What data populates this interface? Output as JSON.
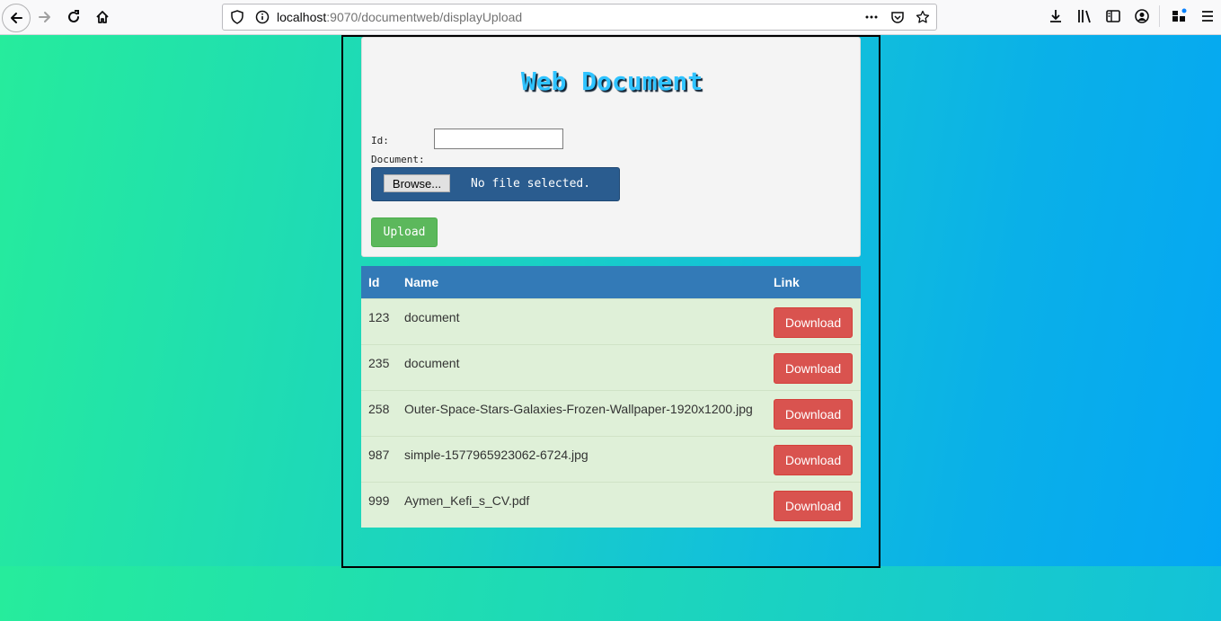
{
  "browser": {
    "url_host": "localhost",
    "url_port_path": ":9070/documentweb/displayUpload"
  },
  "form": {
    "title": "Web Document",
    "id_label": "Id:",
    "id_value": "",
    "document_label": "Document:",
    "browse_label": "Browse...",
    "file_status": "No file selected.",
    "upload_label": "Upload"
  },
  "table": {
    "headers": {
      "id": "Id",
      "name": "Name",
      "link": "Link"
    },
    "rows": [
      {
        "id": "123",
        "name": "document",
        "link": "Download"
      },
      {
        "id": "235",
        "name": "document",
        "link": "Download"
      },
      {
        "id": "258",
        "name": "Outer-Space-Stars-Galaxies-Frozen-Wallpaper-1920x1200.jpg",
        "link": "Download"
      },
      {
        "id": "987",
        "name": "simple-1577965923062-6724.jpg",
        "link": "Download"
      },
      {
        "id": "999",
        "name": "Aymen_Kefi_s_CV.pdf",
        "link": "Download"
      }
    ]
  },
  "colors": {
    "header_blue": "#337ab7",
    "row_green": "#dff0d8",
    "download_red": "#d9534f",
    "upload_green": "#5cb85c",
    "file_box_blue": "#2a5c8f"
  },
  "icons": [
    "back-icon",
    "forward-icon",
    "reload-icon",
    "home-icon",
    "shield-icon",
    "info-icon",
    "more-icon",
    "pocket-icon",
    "star-icon",
    "download-icon",
    "library-icon",
    "sidebar-icon",
    "account-icon",
    "extensions-icon",
    "menu-icon"
  ]
}
